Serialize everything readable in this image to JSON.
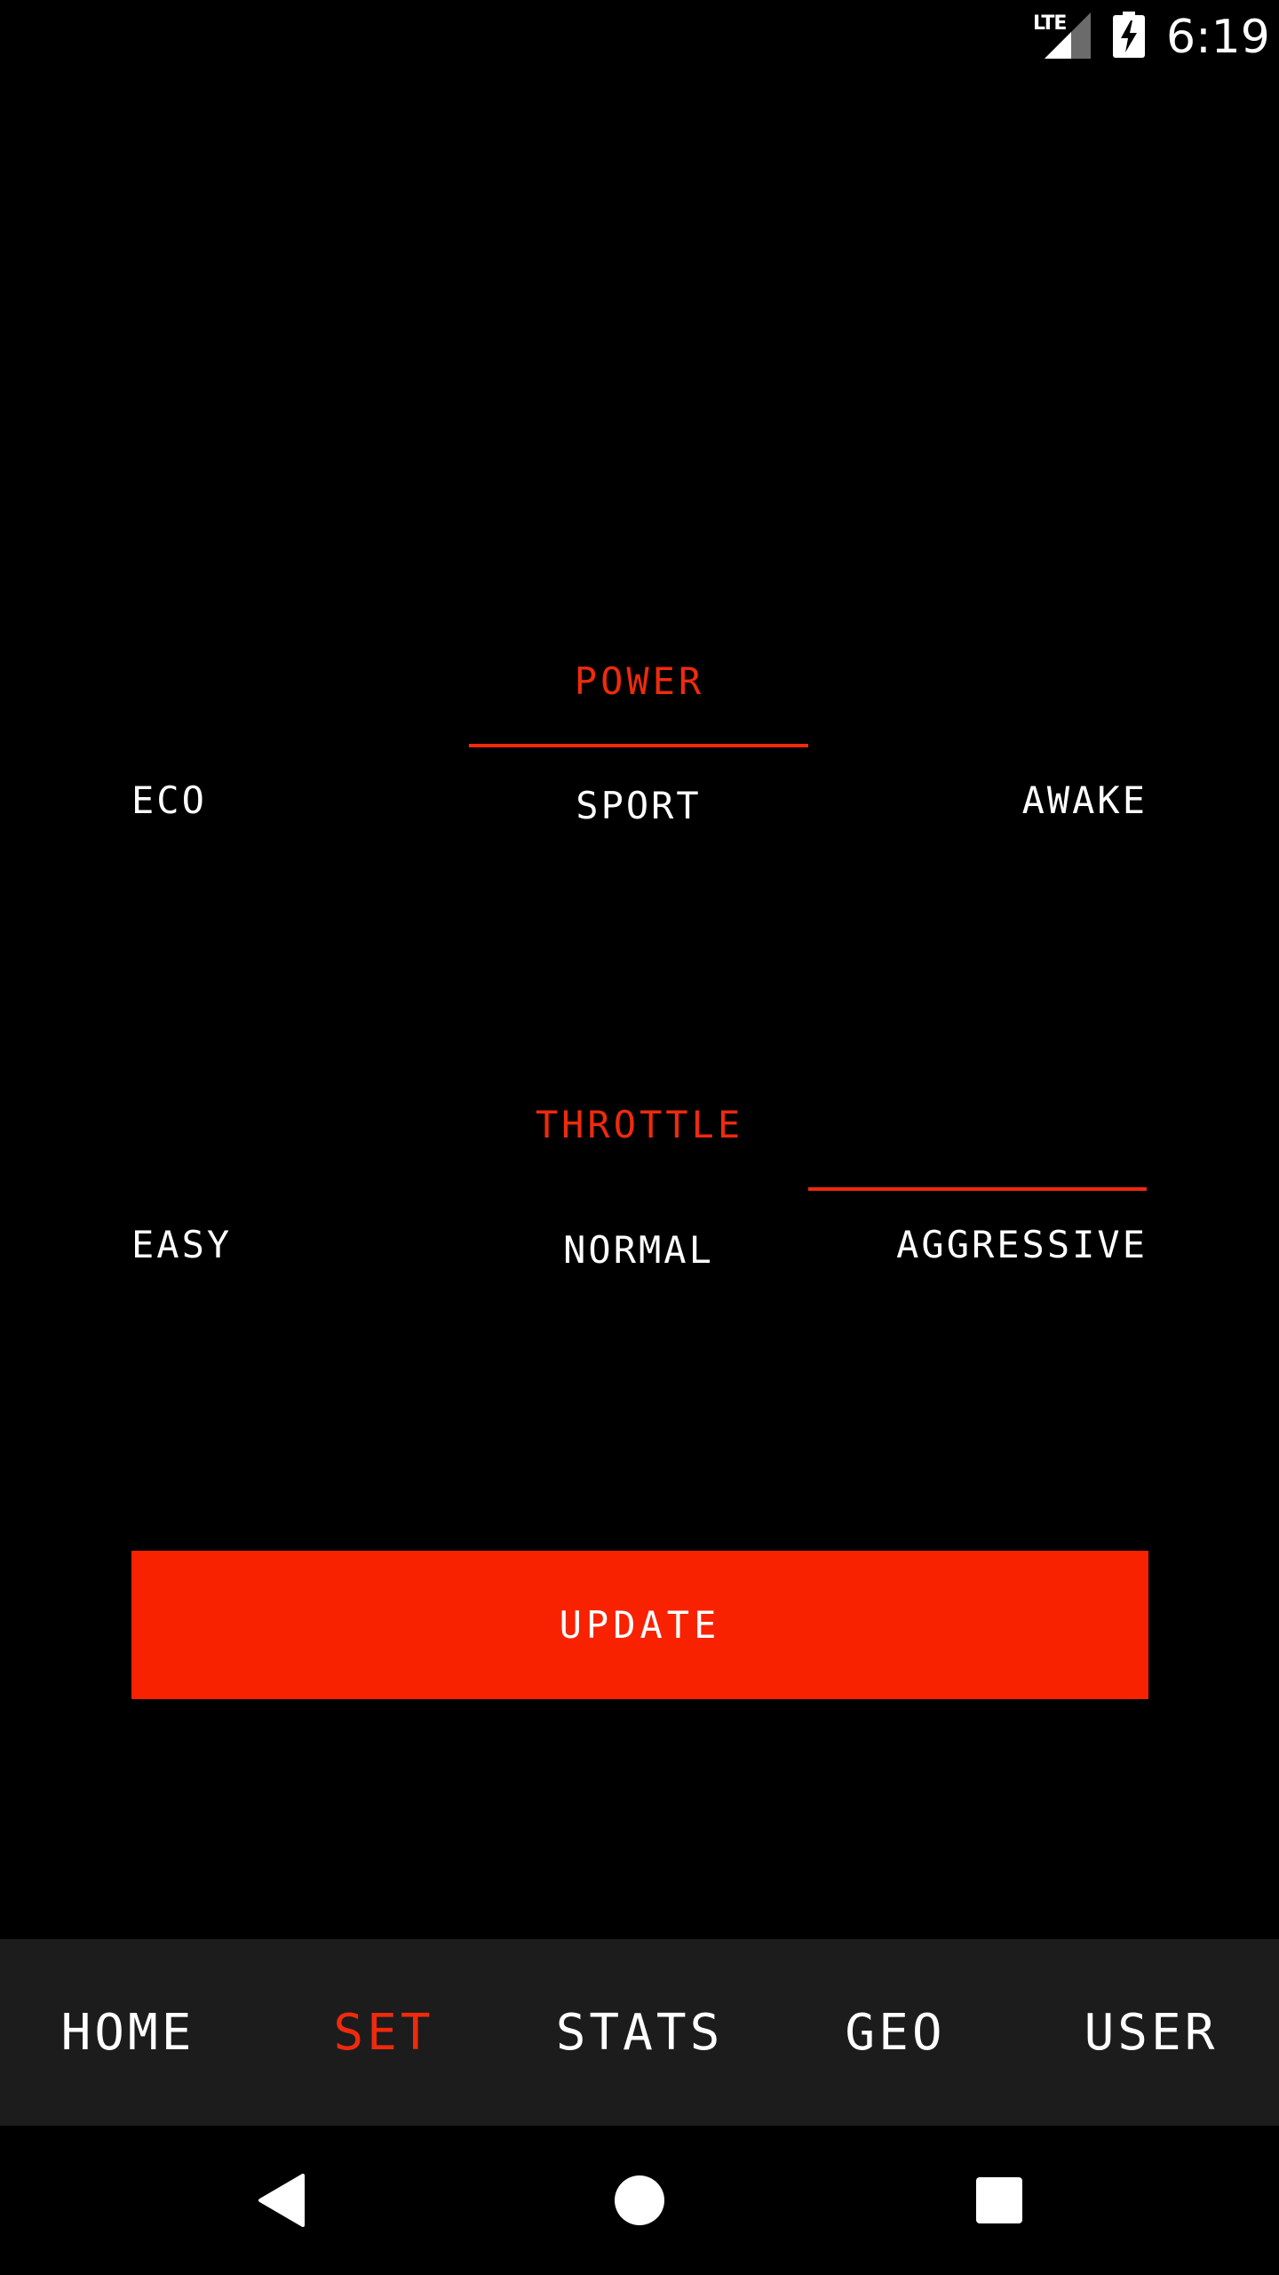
{
  "status_bar": {
    "network": "LTE",
    "time": "6:19",
    "icons": [
      "signal-icon",
      "battery-charging-icon"
    ]
  },
  "power": {
    "title": "POWER",
    "options": [
      "ECO",
      "SPORT",
      "AWAKE"
    ],
    "selected": "SPORT"
  },
  "throttle": {
    "title": "THROTTLE",
    "options": [
      "EASY",
      "NORMAL",
      "AGGRESSIVE"
    ],
    "selected": "AGGRESSIVE"
  },
  "update_button": {
    "label": "UPDATE"
  },
  "tabs": [
    {
      "label": "HOME"
    },
    {
      "label": "SET"
    },
    {
      "label": "STATS"
    },
    {
      "label": "GEO"
    },
    {
      "label": "USER"
    }
  ],
  "active_tab": "SET",
  "nav_bar": {
    "icons": [
      "back-icon",
      "home-icon",
      "recents-icon"
    ]
  },
  "colors": {
    "accent": "#ef2a0d",
    "button": "#f82200",
    "background": "#000000",
    "tab_bar": "#1c1c1c"
  }
}
